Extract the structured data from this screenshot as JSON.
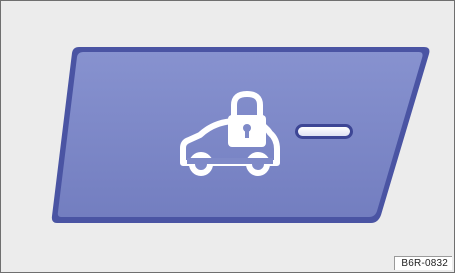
{
  "illustration": {
    "panel_color": "#7f8ac8",
    "panel_edge_color": "#3d4695",
    "icon_color": "#ffffff",
    "icon": "car-lock-icon",
    "indicator": "indicator-light"
  },
  "reference_code": "B6R-0832"
}
